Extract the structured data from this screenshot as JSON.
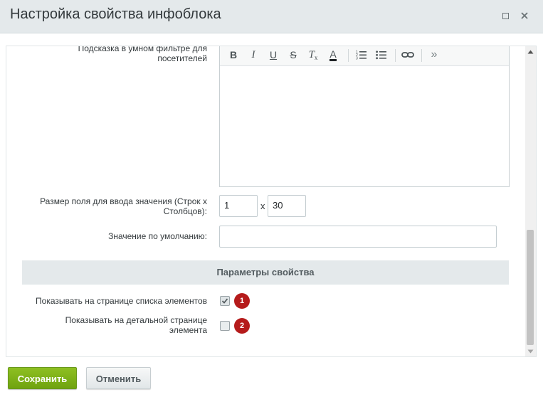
{
  "dialog": {
    "title": "Настройка свойства инфоблока"
  },
  "form": {
    "hint_label_line1": "Подсказка в умном фильтре для",
    "hint_label_line2": "посетителей",
    "size_label_line1": "Размер поля для ввода значения (Строк x",
    "size_label_line2": "Столбцов):",
    "rows_value": "1",
    "size_separator": "x",
    "cols_value": "30",
    "default_label": "Значение по умолчанию:",
    "default_value": ""
  },
  "editor_toolbar": {
    "buttons": [
      "bold",
      "italic",
      "underline",
      "strikethrough",
      "remove-format",
      "font-color",
      "numbered-list",
      "bulleted-list",
      "link",
      "more"
    ],
    "bold": "B",
    "italic": "I",
    "underline": "U",
    "strike": "S",
    "remove_format": "T",
    "font_color": "A",
    "more": "»"
  },
  "section": {
    "title": "Параметры свойства"
  },
  "options": {
    "show_in_list_label": "Показывать на странице списка элементов",
    "show_in_list_checked": true,
    "show_in_list_badge": "1",
    "show_in_detail_label_line1": "Показывать на детальной странице",
    "show_in_detail_label_line2": "элемента",
    "show_in_detail_checked": false,
    "show_in_detail_badge": "2"
  },
  "buttons": {
    "save": "Сохранить",
    "cancel": "Отменить"
  },
  "colors": {
    "save_button": "#7eb11a",
    "badge": "#b51b1b",
    "header_bg": "#e4e9eb"
  }
}
